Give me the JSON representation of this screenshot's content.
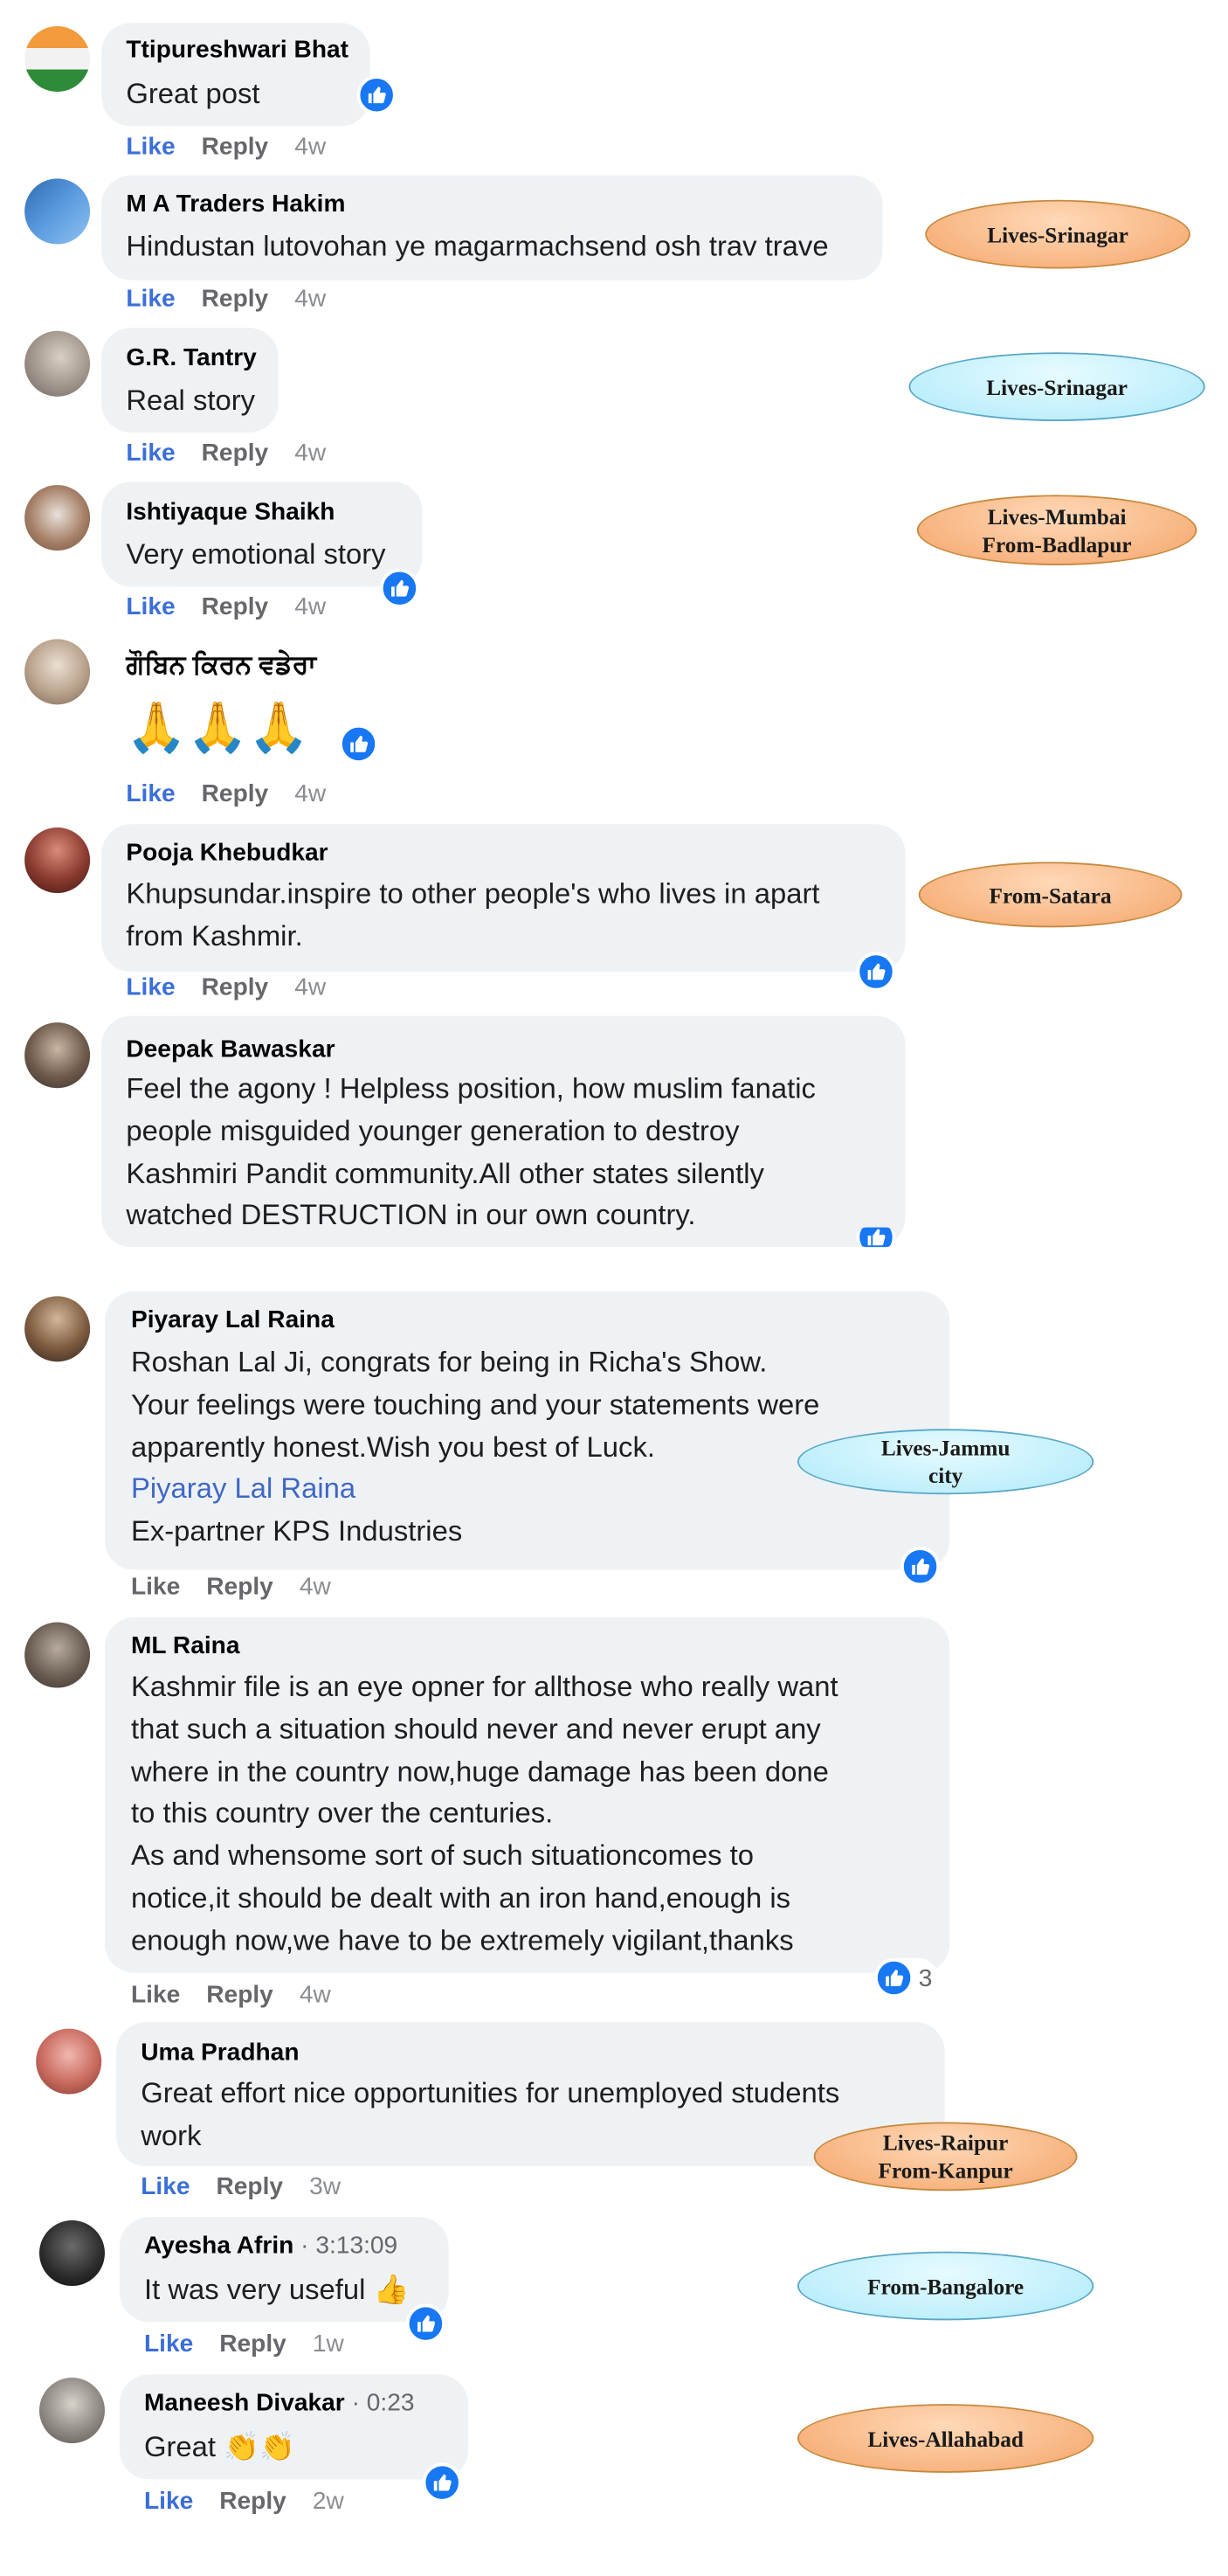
{
  "comments": [
    {
      "name": "Ttipureshwari Bhat",
      "text": [
        "Great post"
      ],
      "like": "Like",
      "reply": "Reply",
      "time": "4w"
    },
    {
      "name": "M A Traders Hakim",
      "text": [
        "Hindustan lutovohan ye magarmachsend osh trav trave"
      ],
      "like": "Like",
      "reply": "Reply",
      "time": "4w"
    },
    {
      "name": "G.R. Tantry",
      "text": [
        "Real story"
      ],
      "like": "Like",
      "reply": "Reply",
      "time": "4w"
    },
    {
      "name": "Ishtiyaque Shaikh",
      "text": [
        "Very emotional story"
      ],
      "like": "Like",
      "reply": "Reply",
      "time": "4w"
    },
    {
      "name": "ਗੌਬਿਨ ਕਿਰਨ ਵਡੇਰਾ",
      "text": [
        "🙏🙏🙏"
      ],
      "like": "Like",
      "reply": "Reply",
      "time": "4w"
    },
    {
      "name": "Pooja Khebudkar",
      "text": [
        "Khupsundar.inspire to other people's who lives in apart",
        "from Kashmir."
      ],
      "like": "Like",
      "reply": "Reply",
      "time": "4w"
    },
    {
      "name": "Deepak Bawaskar",
      "text": [
        "Feel the agony ! Helpless position, how muslim fanatic",
        "people misguided younger generation to destroy",
        "Kashmiri Pandit community.All other states silently",
        "watched DESTRUCTION in our own country."
      ]
    },
    {
      "name": "Piyaray Lal Raina",
      "text": [
        "Roshan Lal Ji, congrats for being in Richa's Show.",
        "Your feelings were touching and your statements were",
        "apparently honest.Wish you best of Luck."
      ],
      "tag": "Piyaray Lal Raina",
      "signature": "Ex-partner KPS Industries",
      "like": "Like",
      "reply": "Reply",
      "time": "4w"
    },
    {
      "name": "ML Raina",
      "text": [
        "Kashmir file is an eye opner for allthose who really want",
        "that such a situation should never and never erupt any",
        "where in the country now,huge damage has been done",
        "to this country over the centuries.",
        "As and whensome sort of such situationcomes to",
        "notice,it should be dealt with an iron hand,enough is",
        "enough now,we have to be extremely vigilant,thanks"
      ],
      "reaction_count": "3",
      "like": "Like",
      "reply": "Reply",
      "time": "4w"
    },
    {
      "name": "Uma Pradhan",
      "text": [
        "Great effort nice opportunities for unemployed students",
        "work"
      ],
      "like": "Like",
      "reply": "Reply",
      "time": "3w"
    },
    {
      "name": "Ayesha Afrin",
      "meta": "· 3:13:09",
      "text": [
        "It was very useful 👍"
      ],
      "like": "Like",
      "reply": "Reply",
      "time": "1w"
    },
    {
      "name": "Maneesh Divakar",
      "meta": "· 0:23",
      "text": [
        "Great 👏👏"
      ],
      "like": "Like",
      "reply": "Reply",
      "time": "2w"
    }
  ],
  "annotations": [
    {
      "lines": [
        "Lives-Srinagar"
      ],
      "color": "orange"
    },
    {
      "lines": [
        "Lives-Srinagar"
      ],
      "color": "blue"
    },
    {
      "lines": [
        "Lives-Mumbai",
        "From-Badlapur"
      ],
      "color": "orange"
    },
    {
      "lines": [
        "From-Satara"
      ],
      "color": "orange"
    },
    {
      "lines": [
        "Lives-Jammu",
        "city"
      ],
      "color": "blue"
    },
    {
      "lines": [
        "Lives-Raipur",
        "From-Kanpur"
      ],
      "color": "orange"
    },
    {
      "lines": [
        "From-Bangalore"
      ],
      "color": "blue"
    },
    {
      "lines": [
        "Lives-Allahabad"
      ],
      "color": "orange"
    }
  ],
  "icons": {
    "reaction": "thumbs-up-icon",
    "avatar": "profile-photo"
  },
  "colors": {
    "like": "#3b6fd8",
    "bubble": "#eff2f5",
    "reaction": "#1877f2",
    "orange_oval": "#f7b27d",
    "blue_oval": "#bdeefc"
  }
}
